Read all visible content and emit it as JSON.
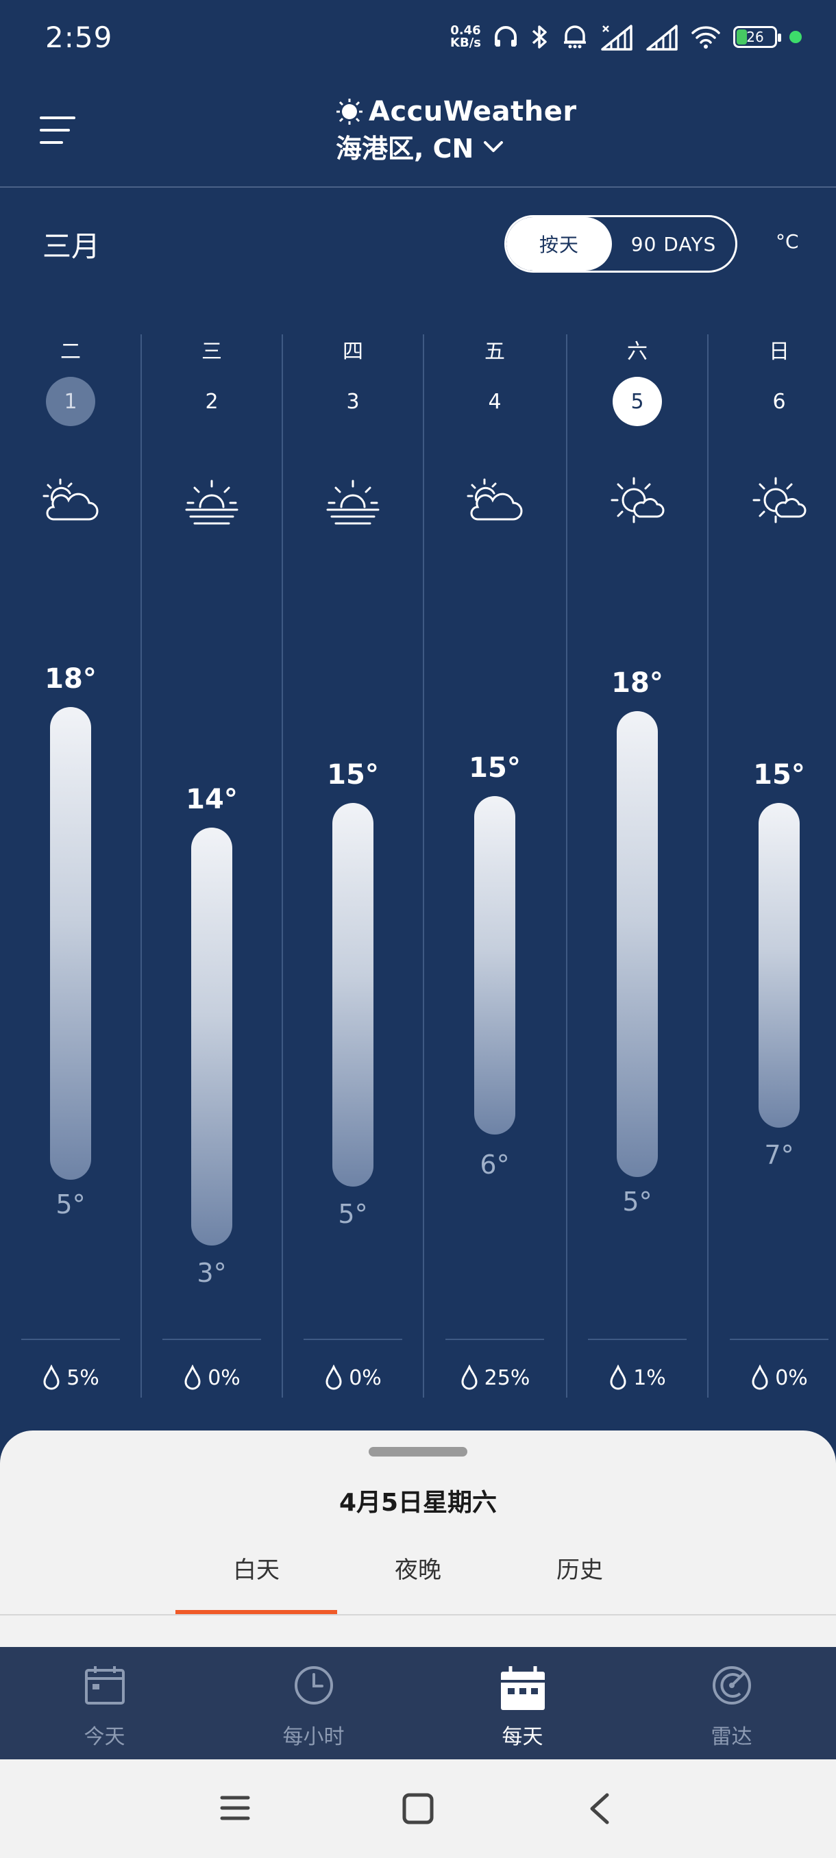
{
  "status": {
    "time": "2:59",
    "net_speed_value": "0.46",
    "net_speed_unit": "KB/s",
    "battery": "26"
  },
  "header": {
    "brand": "AccuWeather",
    "location": "海港区, CN"
  },
  "month": "三月",
  "toggle": {
    "daily": "按天",
    "ninety": "90 DAYS"
  },
  "unit": "°C",
  "days": [
    {
      "weekday": "二",
      "date": "1",
      "icon": "partly-cloudy-icon",
      "high": "18°",
      "low": "5°",
      "precip": "5%"
    },
    {
      "weekday": "三",
      "date": "2",
      "icon": "hazy-sun-icon",
      "high": "14°",
      "low": "3°",
      "precip": "0%"
    },
    {
      "weekday": "四",
      "date": "3",
      "icon": "hazy-sun-icon",
      "high": "15°",
      "low": "5°",
      "precip": "0%"
    },
    {
      "weekday": "五",
      "date": "4",
      "icon": "partly-cloudy-icon",
      "high": "15°",
      "low": "6°",
      "precip": "25%"
    },
    {
      "weekday": "六",
      "date": "5",
      "icon": "mostly-sunny-icon",
      "high": "18°",
      "low": "5°",
      "precip": "1%"
    },
    {
      "weekday": "日",
      "date": "6",
      "icon": "mostly-sunny-icon",
      "high": "15°",
      "low": "7°",
      "precip": "0%"
    }
  ],
  "sheet": {
    "date": "4月5日星期六",
    "tabs": [
      "白天",
      "夜晚",
      "历史"
    ]
  },
  "nav": [
    "今天",
    "每小时",
    "每天",
    "雷达"
  ]
}
